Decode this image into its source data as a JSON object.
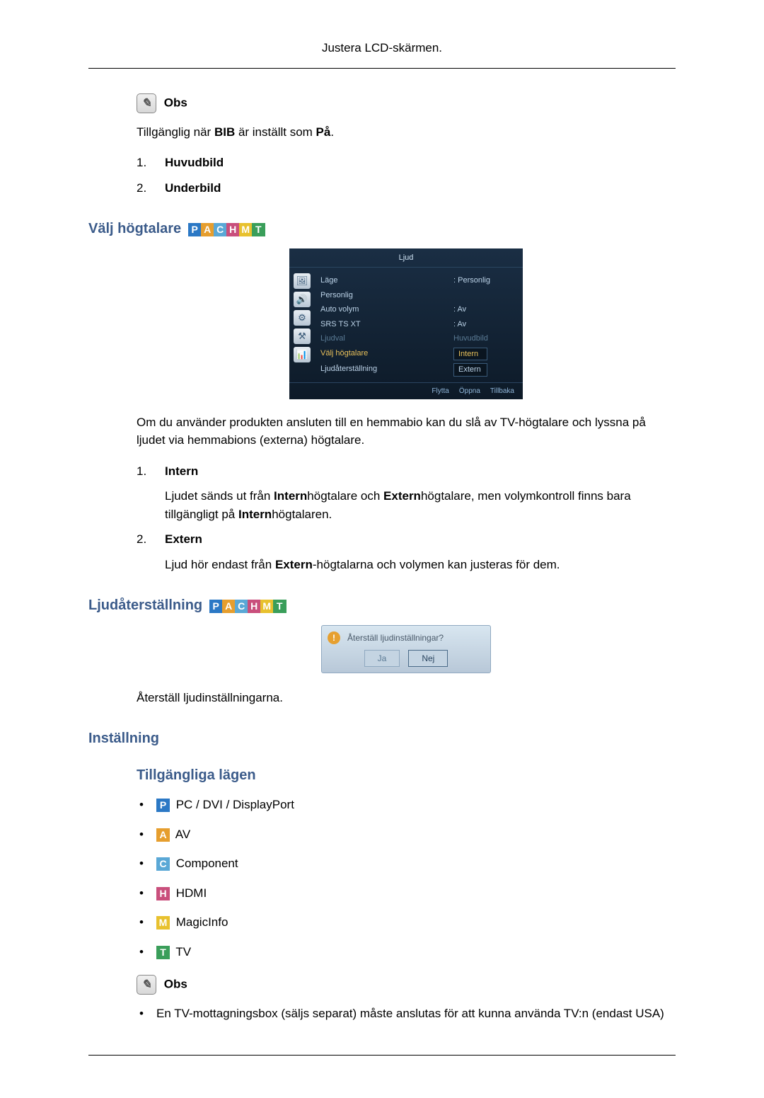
{
  "header": {
    "title": "Justera LCD-skärmen."
  },
  "obs1": {
    "label": "Obs",
    "text_prefix": "Tillgänglig när ",
    "text_bold1": "BIB",
    "text_mid": " är inställt som ",
    "text_bold2": "På",
    "text_suffix": ".",
    "items": [
      {
        "num": "1.",
        "label": "Huvudbild"
      },
      {
        "num": "2.",
        "label": "Underbild"
      }
    ]
  },
  "sec_valj": {
    "title": "Välj högtalare",
    "osd": {
      "title": "Ljud",
      "rows": [
        {
          "lbl": "Läge",
          "val": ": Personlig",
          "cls": ""
        },
        {
          "lbl": "Personlig",
          "val": "",
          "cls": ""
        },
        {
          "lbl": "Auto volym",
          "val": ": Av",
          "cls": ""
        },
        {
          "lbl": "SRS TS XT",
          "val": ": Av",
          "cls": ""
        },
        {
          "lbl": "Ljudval",
          "val": "Huvudbild",
          "cls": "dim"
        },
        {
          "lbl": "Välj högtalare",
          "val": "Intern",
          "cls": "sel",
          "box": true
        },
        {
          "lbl": "Ljudåterställning",
          "val": "Extern",
          "cls": "",
          "box": true
        }
      ],
      "footer": [
        "Flytta",
        "Öppna",
        "Tillbaka"
      ]
    },
    "para": "Om du använder produkten ansluten till en hemmabio kan du slå av TV-högtalare och lyssna på ljudet via hemmabions (externa) högtalare.",
    "items": [
      {
        "num": "1.",
        "title": "Intern",
        "body_parts": [
          {
            "t": "Ljudet sänds ut från ",
            "b": false
          },
          {
            "t": "Intern",
            "b": true
          },
          {
            "t": "högtalare och ",
            "b": false
          },
          {
            "t": "Extern",
            "b": true
          },
          {
            "t": "högtalare, men volymkontroll finns bara tillgängligt på ",
            "b": false
          },
          {
            "t": "Intern",
            "b": true
          },
          {
            "t": "högtalaren.",
            "b": false
          }
        ]
      },
      {
        "num": "2.",
        "title": "Extern",
        "body_parts": [
          {
            "t": "Ljud hör endast från ",
            "b": false
          },
          {
            "t": "Extern",
            "b": true
          },
          {
            "t": "-högtalarna och volymen kan justeras för dem.",
            "b": false
          }
        ]
      }
    ]
  },
  "sec_reset": {
    "title": "Ljudåterställning",
    "dialog": {
      "question": "Återställ ljudinställningar?",
      "yes": "Ja",
      "no": "Nej"
    },
    "para": "Återställ ljudinställningarna."
  },
  "sec_installning": {
    "title": "Inställning",
    "subtitle": "Tillgängliga lägen",
    "modes": [
      {
        "badge": "P",
        "cls": "badge-P",
        "label": " PC / DVI / DisplayPort"
      },
      {
        "badge": "A",
        "cls": "badge-A",
        "label": " AV"
      },
      {
        "badge": "C",
        "cls": "badge-C",
        "label": " Component"
      },
      {
        "badge": "H",
        "cls": "badge-H",
        "label": " HDMI"
      },
      {
        "badge": "M",
        "cls": "badge-M",
        "label": " MagicInfo"
      },
      {
        "badge": "T",
        "cls": "badge-T",
        "label": " TV"
      }
    ]
  },
  "obs2": {
    "label": "Obs",
    "bullet": "En TV-mottagningsbox (säljs separat) måste anslutas för att kunna använda TV:n (endast USA)"
  },
  "badges_all": [
    "P",
    "A",
    "C",
    "H",
    "M",
    "T"
  ]
}
